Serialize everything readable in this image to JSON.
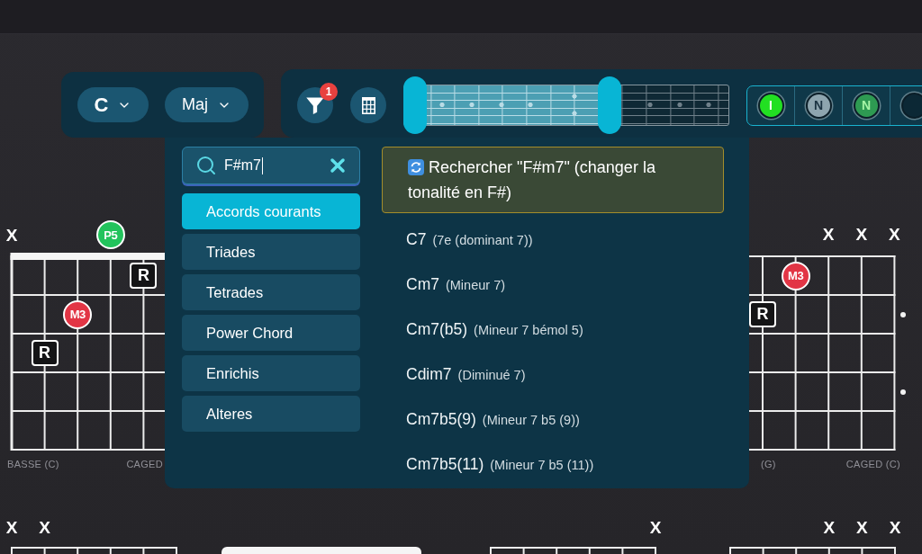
{
  "key_select": {
    "value": "C"
  },
  "quality_select": {
    "value": "Maj"
  },
  "filter_button": {
    "count": "1"
  },
  "fret_range": {
    "level": 0.67
  },
  "note_toggles": [
    {
      "label": "I",
      "color": "#22e022"
    },
    {
      "label": "N",
      "color": "#8ea5af"
    },
    {
      "label": "N",
      "color": "#2e9a52"
    },
    {
      "color": "#0c2835"
    }
  ],
  "chord_diagrams": [
    {
      "kind": "cut_right",
      "nut": true,
      "inlay_dots": false,
      "open_strings": [
        {
          "kind": "mute",
          "text": "X"
        },
        {
          "kind": "none"
        },
        {
          "kind": "none"
        },
        {
          "kind": "fifth",
          "text": "P5"
        },
        {
          "kind": "none"
        }
      ],
      "frets": [
        [
          {
            "kind": "none"
          },
          {
            "kind": "none"
          },
          {
            "kind": "none"
          },
          {
            "kind": "none"
          },
          {
            "kind": "root",
            "text": "R"
          }
        ],
        [
          {
            "kind": "none"
          },
          {
            "kind": "none"
          },
          {
            "kind": "third",
            "text": "M3"
          },
          {
            "kind": "none"
          },
          {
            "kind": "none"
          }
        ],
        [
          {
            "kind": "none"
          },
          {
            "kind": "root",
            "text": "R"
          },
          {
            "kind": "none"
          },
          {
            "kind": "none"
          },
          {
            "kind": "none"
          }
        ]
      ],
      "bass_label": "BASSE (C)",
      "caged_label": "CAGED"
    },
    {
      "kind": "cut_left",
      "nut": false,
      "inlay_dots": true,
      "open_strings": [
        {
          "kind": "none"
        },
        {
          "kind": "none"
        },
        {
          "kind": "mute",
          "text": "X"
        },
        {
          "kind": "mute",
          "text": "X"
        },
        {
          "kind": "mute",
          "text": "X"
        }
      ],
      "frets": [
        [
          {
            "kind": "none"
          },
          {
            "kind": "third",
            "text": "M3"
          },
          {
            "kind": "none"
          },
          {
            "kind": "none"
          },
          {
            "kind": "none"
          }
        ],
        [
          {
            "kind": "root",
            "text": "R"
          },
          {
            "kind": "none"
          },
          {
            "kind": "none"
          },
          {
            "kind": "none"
          },
          {
            "kind": "none"
          }
        ]
      ],
      "bass_label": "(G)",
      "caged_label": "CAGED (C)"
    }
  ],
  "lower_diagrams": [
    {
      "nut": false,
      "open_strings": [
        {
          "kind": "mute",
          "text": "X"
        },
        {
          "kind": "mute",
          "text": "X"
        },
        {
          "kind": "none"
        },
        {
          "kind": "none"
        },
        {
          "kind": "none"
        },
        {
          "kind": "none"
        }
      ]
    },
    {
      "nut": true
    },
    {
      "nut": false,
      "open_strings": [
        {
          "kind": "none"
        },
        {
          "kind": "none"
        },
        {
          "kind": "none"
        },
        {
          "kind": "none"
        },
        {
          "kind": "none"
        },
        {
          "kind": "mute",
          "text": "X"
        }
      ]
    },
    {
      "nut": false,
      "open_strings": [
        {
          "kind": "none"
        },
        {
          "kind": "none"
        },
        {
          "kind": "none"
        },
        {
          "kind": "mute",
          "text": "X"
        },
        {
          "kind": "mute",
          "text": "X"
        },
        {
          "kind": "mute",
          "text": "X"
        }
      ]
    }
  ],
  "chord_search": {
    "query": "F#m7",
    "categories": [
      {
        "label": "Accords courants",
        "selected": true
      },
      {
        "label": "Triades",
        "selected": false
      },
      {
        "label": "Tetrades",
        "selected": false
      },
      {
        "label": "Power Chord",
        "selected": false
      },
      {
        "label": "Enrichis",
        "selected": false
      },
      {
        "label": "Alteres",
        "selected": false
      }
    ],
    "suggestion": "Rechercher \"F#m7\" (changer la tonalité en F#)",
    "results": [
      {
        "name": "C7",
        "description": "(7e (dominant 7))"
      },
      {
        "name": "Cm7",
        "description": "(Mineur 7)"
      },
      {
        "name": "Cm7(b5)",
        "description": "(Mineur 7 bémol 5)"
      },
      {
        "name": "Cdim7",
        "description": "(Diminué 7)"
      },
      {
        "name": "Cm7b5(9)",
        "description": "(Mineur 7 b5 (9))"
      },
      {
        "name": "Cm7b5(11)",
        "description": "(Mineur 7 b5 (11))"
      }
    ]
  }
}
